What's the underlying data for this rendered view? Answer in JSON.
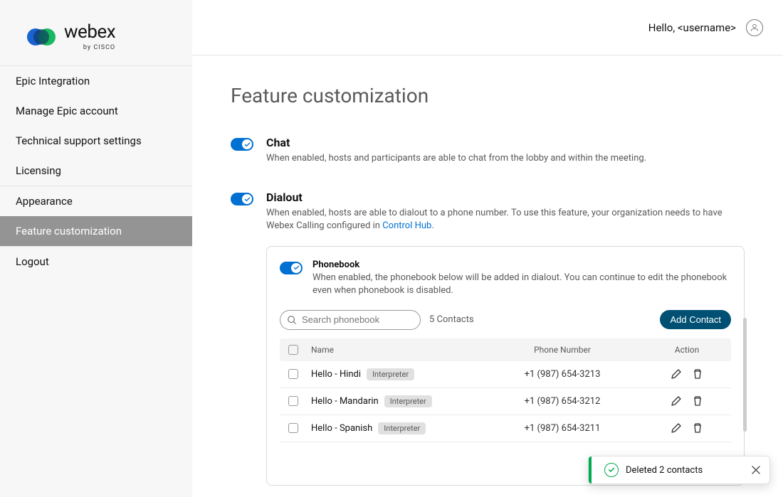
{
  "brand": {
    "word": "webex",
    "sub": "by CISCO"
  },
  "sidebar": {
    "groups": [
      {
        "items": [
          {
            "label": "Epic Integration",
            "active": false
          },
          {
            "label": "Manage Epic account",
            "active": false
          },
          {
            "label": "Technical support settings",
            "active": false
          },
          {
            "label": "Licensing",
            "active": false
          }
        ]
      },
      {
        "items": [
          {
            "label": "Appearance",
            "active": false
          },
          {
            "label": "Feature customization",
            "active": true
          }
        ]
      },
      {
        "items": [
          {
            "label": "Logout",
            "active": false
          }
        ]
      }
    ]
  },
  "header": {
    "greeting": "Hello, <username>"
  },
  "page": {
    "title": "Feature customization"
  },
  "features": {
    "chat": {
      "title": "Chat",
      "desc": "When enabled, hosts and participants are able to chat from the lobby and within the meeting.",
      "on": true
    },
    "dialout": {
      "title": "Dialout",
      "desc_pre": "When enabled, hosts are able to dialout to a phone number. To use this feature, your organization needs to have Webex Calling configured in ",
      "link": "Control Hub",
      "desc_post": ".",
      "on": true
    }
  },
  "phonebook": {
    "title": "Phonebook",
    "desc": "When enabled, the phonebook below will be added in dialout. You can continue to edit the phonebook even when phonebook is disabled.",
    "on": true,
    "search_placeholder": "Search phonebook",
    "count": "5 Contacts",
    "add_label": "Add Contact",
    "cols": {
      "name": "Name",
      "phone": "Phone Number",
      "action": "Action"
    },
    "badge": "Interpreter",
    "rows": [
      {
        "name": "Hello - Hindi",
        "phone": "+1 (987) 654-3213"
      },
      {
        "name": "Hello - Mandarin",
        "phone": "+1 (987) 654-3212"
      },
      {
        "name": "Hello - Spanish",
        "phone": "+1 (987) 654-3211"
      }
    ]
  },
  "toast": {
    "text": "Deleted 2 contacts"
  }
}
